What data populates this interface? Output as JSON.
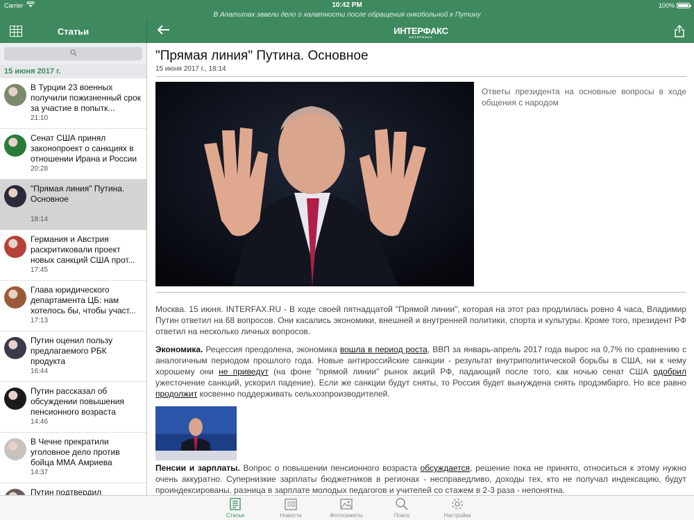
{
  "status": {
    "carrier": "Carrier",
    "time": "10:42 PM",
    "battery": "100%"
  },
  "ticker": "В Апатитах завели дело о халатности после обращения онкобольной к Путину",
  "nav": {
    "section_title": "Статьи",
    "logo_main": "ИНТЕРФАКС",
    "logo_sub": "ИНТЕРФАКС"
  },
  "sidebar": {
    "date": "15 июня 2017 г.",
    "items": [
      {
        "title": "В Турции 23 военных получили пожизненный срок за участие в попытк...",
        "time": "21:10",
        "thumb": "#7a8a6a"
      },
      {
        "title": "Сенат США принял законопроект о санкциях в отношении Ирана и России",
        "time": "20:28",
        "thumb": "#2b7a3a"
      },
      {
        "title": "\"Прямая линия\" Путина. Основное",
        "time": "18:14",
        "thumb": "#2a2a3a"
      },
      {
        "title": "Германия и Австрия раскритиковали проект новых санкций США прот...",
        "time": "17:45",
        "thumb": "#b5423a"
      },
      {
        "title": "Глава юридического департамента ЦБ: нам хотелось бы, чтобы участ...",
        "time": "17:13",
        "thumb": "#9a5a3a"
      },
      {
        "title": "Путин оценил пользу предлагаемого РБК продукта",
        "time": "16:44",
        "thumb": "#3a3a4a"
      },
      {
        "title": "Путин рассказал об обсуждении повышения пенсионного возраста",
        "time": "14:46",
        "thumb": "#1a1a1a"
      },
      {
        "title": "В Чечне прекратили уголовное дело против бойца ММА Амриева",
        "time": "14:37",
        "thumb": "#c9c3c0"
      },
      {
        "title": "Путин подтвердил",
        "time": "",
        "thumb": "#6a5a5a"
      }
    ]
  },
  "article": {
    "title": "\"Прямая линия\" Путина. Основное",
    "date": "15 июня 2017 г., 18:14",
    "caption": "Ответы президента на основные вопросы в ходе общения с народом",
    "p1": "Москва. 15 июня. INTERFAX.RU - В ходе своей пятнадцатой \"Прямой линии\", которая на этот раз продлилась ровно 4 часа, Владимир Путин ответил на 68 вопросов. Они касались экономики, внешней и внутренней политики, спорта и культуры. Кроме того, президент РФ ответил на несколько личных вопросов.",
    "p2_head": "Экономика.",
    "p2_a": " Рецессия преодолена, экономика ",
    "p2_link1": "вошла в период роста",
    "p2_b": ", ВВП за январь-апрель 2017 года вырос на 0,7% по сравнению с аналогичным периодом прошлого года. Новые антироссийские санкции - результат внутриполитической борьбы в США, ни к чему хорошему они ",
    "p2_link2": "не приведут",
    "p2_c": " (на фоне \"прямой линии\" рынок акций РФ, падающий после того, как ночью сенат США ",
    "p2_link3": "одобрил",
    "p2_d": " ужесточение санкций, ускорил падение). Если же санкции будут сняты, то Россия будет вынуждена снять продэмбарго. Но все равно ",
    "p2_link4": "продолжит",
    "p2_e": " косвенно поддерживать сельхозпроизводителей.",
    "p3_head": "Пенсии и зарплаты.",
    "p3_a": " Вопрос о повышении пенсионного возраста ",
    "p3_link1": "обсуждается",
    "p3_b": ", решение пока не принято, относиться к этому нужно очень аккуратно. Супернизкие зарплаты бюджетников в регионах - несправедливо, доходы тех, кто не получал индексацию, будут проиндексированы, разница в зарплате молодых педагогов и учителей со стажем в 2-3 раза - непонятна."
  },
  "tabs": [
    {
      "label": "Статьи",
      "icon": "articles-icon"
    },
    {
      "label": "Новости",
      "icon": "news-icon"
    },
    {
      "label": "Фотосюжеты",
      "icon": "photo-icon"
    },
    {
      "label": "Поиск",
      "icon": "search-icon"
    },
    {
      "label": "Настройки",
      "icon": "gear-icon"
    }
  ],
  "colors": {
    "brand": "#3e8a5e",
    "active_row": "#d4d4d4"
  }
}
